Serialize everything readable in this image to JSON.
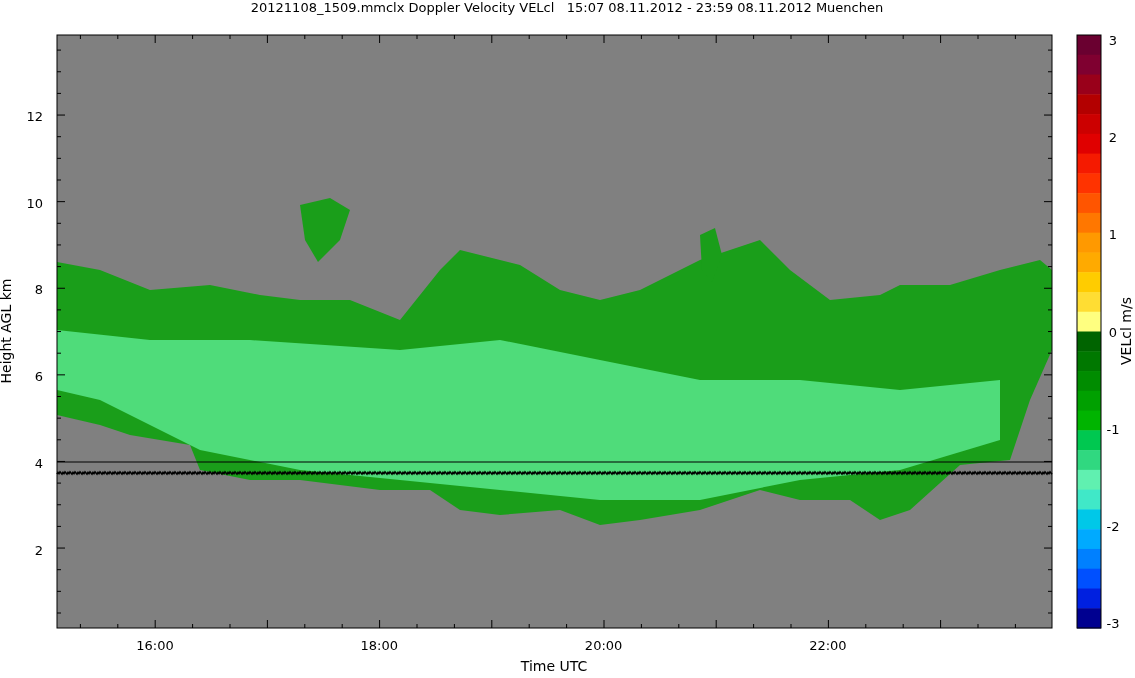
{
  "title": "20121108_1509.mmclx Doppler Velocity VELcl   15:07 08.11.2012 - 23:59 08.11.2012 Muenchen",
  "plot": {
    "xlabel": "Time UTC",
    "ylabel": "Height AGL km",
    "xticks": [
      "16:00",
      "18:00",
      "20:00",
      "22:00"
    ],
    "yticks": [
      "12",
      "10",
      "8",
      "6",
      "4",
      "2"
    ]
  },
  "colorbar": {
    "label": "VELcl m/s",
    "ticks": [
      "3",
      "2",
      "1",
      "0",
      "-1",
      "-2",
      "-3"
    ],
    "bands": [
      {
        "color": "#6a0030"
      },
      {
        "color": "#7f0030"
      },
      {
        "color": "#99001a"
      },
      {
        "color": "#b30000"
      },
      {
        "color": "#cc0000"
      },
      {
        "color": "#e00000"
      },
      {
        "color": "#f51a00"
      },
      {
        "color": "#ff3300"
      },
      {
        "color": "#ff5500"
      },
      {
        "color": "#ff7700"
      },
      {
        "color": "#ff9900"
      },
      {
        "color": "#ffaa00"
      },
      {
        "color": "#ffcc00"
      },
      {
        "color": "#ffdd33"
      },
      {
        "color": "#ffff80"
      },
      {
        "color": "#006400"
      },
      {
        "color": "#007800"
      },
      {
        "color": "#008c00"
      },
      {
        "color": "#00a000"
      },
      {
        "color": "#00b400"
      },
      {
        "color": "#00c850"
      },
      {
        "color": "#30d880"
      },
      {
        "color": "#60f0b0"
      },
      {
        "color": "#40e8c8"
      },
      {
        "color": "#00c8e8"
      },
      {
        "color": "#00aaff"
      },
      {
        "color": "#0080ff"
      },
      {
        "color": "#0050ff"
      },
      {
        "color": "#0020e0"
      },
      {
        "color": "#000090"
      }
    ]
  }
}
